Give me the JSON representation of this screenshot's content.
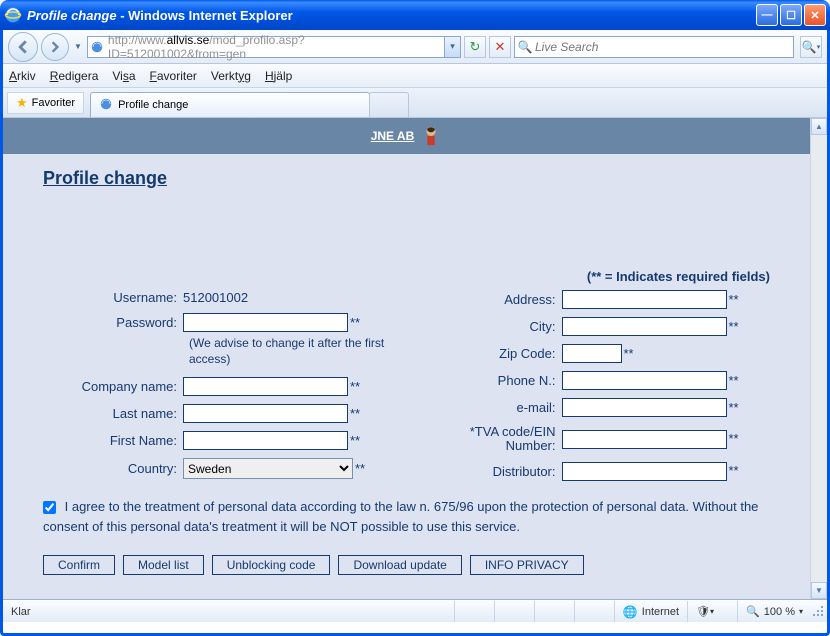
{
  "window": {
    "title_page": "Profile change",
    "title_app": "Windows Internet Explorer"
  },
  "navbar": {
    "url_prefix": "http://www.",
    "url_host": "allvis.se",
    "url_path": "/mod_profilo.asp?ID=512001002&from=gen",
    "search_placeholder": "Live Search"
  },
  "menubar": {
    "arkiv": "Arkiv",
    "redigera": "Redigera",
    "visa": "Visa",
    "favoriter": "Favoriter",
    "verktyg": "Verktyg",
    "hjalp": "Hjälp"
  },
  "tabsbar": {
    "favorites": "Favoriter",
    "tab_title": "Profile change"
  },
  "page": {
    "brand": "JNE AB",
    "heading": "Profile change",
    "required_note": "(** = Indicates required fields)",
    "labels": {
      "username": "Username:",
      "password": "Password:",
      "company": "Company name:",
      "lastname": "Last name:",
      "firstname": "First Name:",
      "country": "Country:",
      "address": "Address:",
      "city": "City:",
      "zip": "Zip Code:",
      "phone": "Phone N.:",
      "email": "e-mail:",
      "tva": "*TVA code/EIN Number:",
      "distributor": "Distributor:"
    },
    "values": {
      "username": "512001002",
      "country": "Sweden"
    },
    "hint": "(We advise to change it after the first access)",
    "consent": "I agree to the treatment of personal data according to the law n. 675/96 upon the protection of personal data. Without the consent of this personal data's treatment it will be NOT possible to use this service.",
    "buttons": {
      "confirm": "Confirm",
      "model": "Model list",
      "unblock": "Unblocking code",
      "download": "Download update",
      "privacy": "INFO PRIVACY"
    }
  },
  "statusbar": {
    "ready": "Klar",
    "zone": "Internet",
    "zoom": "100 %"
  }
}
